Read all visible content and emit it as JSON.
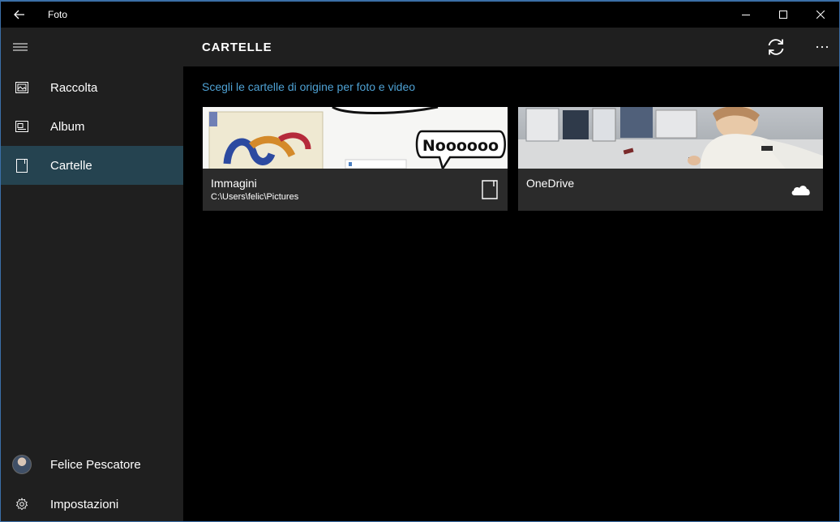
{
  "window": {
    "title": "Foto"
  },
  "sidebar": {
    "items": [
      {
        "label": "Raccolta",
        "icon": "collection-icon"
      },
      {
        "label": "Album",
        "icon": "album-icon"
      },
      {
        "label": "Cartelle",
        "icon": "folder-icon",
        "selected": true
      }
    ],
    "user": {
      "label": "Felice Pescatore",
      "icon": "avatar"
    },
    "settings": {
      "label": "Impostazioni",
      "icon": "gear-icon"
    }
  },
  "main": {
    "title": "CARTELLE",
    "subtitle_link": "Scegli le cartelle di origine per foto e video",
    "folders": [
      {
        "name": "Immagini",
        "path": "C:\\Users\\felic\\Pictures",
        "thumb_text": "Noooooo",
        "icon": "folder-icon"
      },
      {
        "name": "OneDrive",
        "path": "",
        "icon": "cloud-icon"
      }
    ]
  },
  "colors": {
    "sidebar_bg": "#1f1f1f",
    "selected_bg": "#254350",
    "accent_link": "#4ea1d3",
    "tile_bg": "#2b2b2b"
  }
}
